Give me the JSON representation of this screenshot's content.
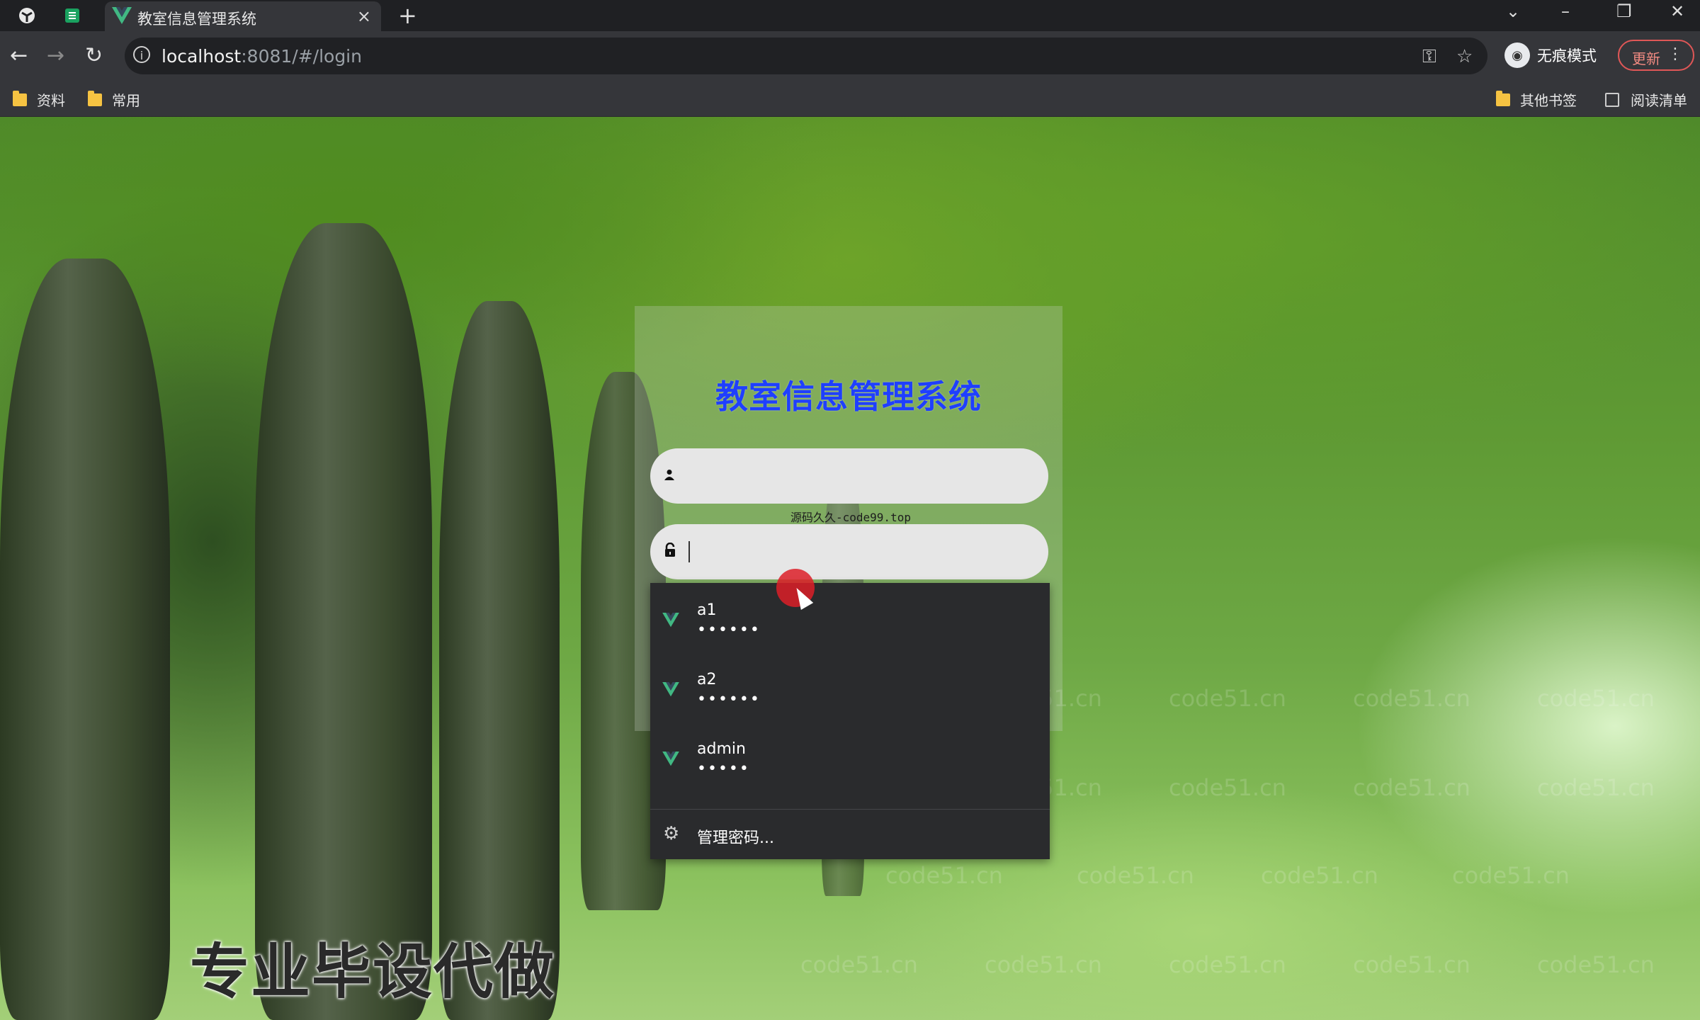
{
  "browser": {
    "tab_title": "教室信息管理系统",
    "tab_close": "×",
    "new_tab": "+",
    "url_host": "localhost",
    "url_rest": ":8081/#/login",
    "incognito_label": "无痕模式",
    "update_label": "更新",
    "menu_dots": "⋮",
    "bookmarks": [
      {
        "label": "资料"
      },
      {
        "label": "常用"
      }
    ],
    "other_bookmarks": "其他书签",
    "reading_list": "阅读清单"
  },
  "login": {
    "title": "教室信息管理系统",
    "username_placeholder": "",
    "password_placeholder": "",
    "source_note": "源码久久-code99.top"
  },
  "autofill": {
    "items": [
      {
        "username": "a1",
        "password": "••••••"
      },
      {
        "username": "a2",
        "password": "••••••"
      },
      {
        "username": "admin",
        "password": "•••••"
      }
    ],
    "manage_label": "管理密码..."
  },
  "overlay": {
    "watermark": "code51.cn",
    "promo": "专业毕设代做"
  },
  "colors": {
    "title": "#1f3fff",
    "vue_green": "#41b883",
    "update_border": "#e05757"
  }
}
